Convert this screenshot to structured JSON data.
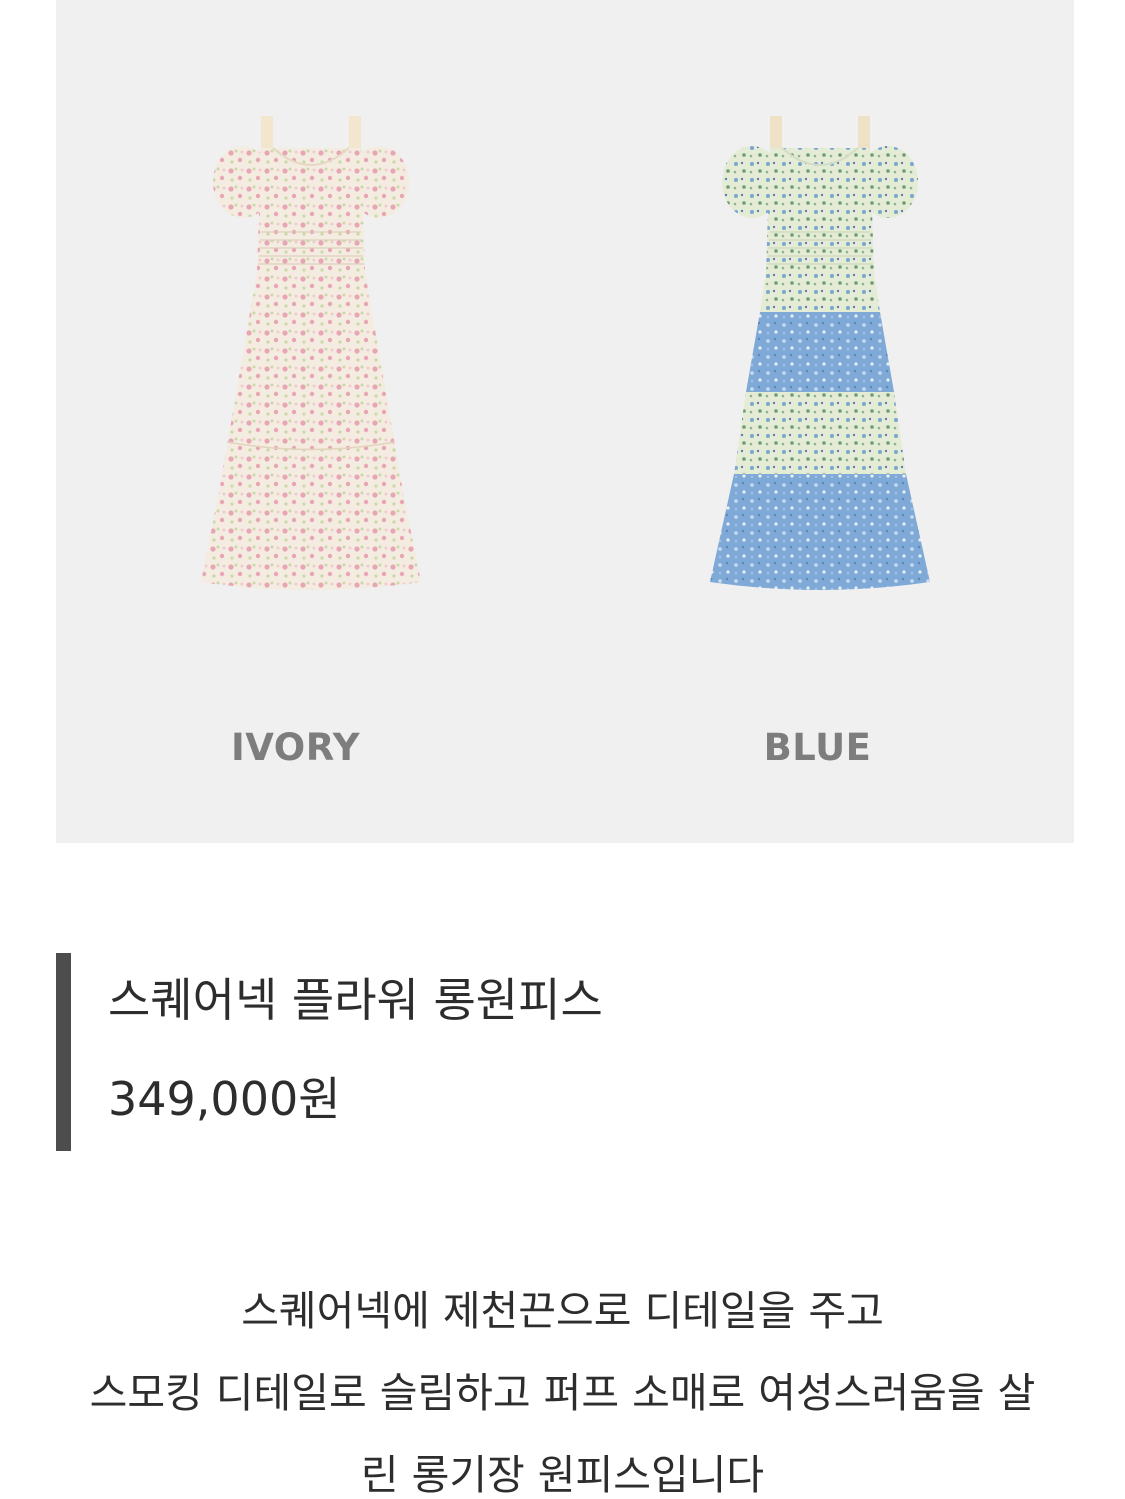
{
  "variants": [
    {
      "label": "IVORY",
      "colors": {
        "base": "#f4ece0",
        "floral_a": "#e8a6b5",
        "floral_b": "#c9d9a8",
        "lace": "#f2e6cf"
      }
    },
    {
      "label": "BLUE",
      "colors": {
        "base": "#e4ecd6",
        "floral_a": "#7aa5cf",
        "floral_b": "#6f9a6f",
        "tier": "#7fa9d6",
        "lace": "#efe1c6"
      }
    }
  ],
  "product": {
    "name": "스퀘어넥 플라워 롱원피스",
    "price": "349,000원"
  },
  "description": {
    "lines": [
      "스퀘어넥에 제천끈으로 디테일을 주고",
      "스모킹 디테일로 슬림하고 퍼프 소매로 여성스러움을 살",
      "린 롱기장 원피스입니다"
    ]
  },
  "colors": {
    "panel_bg": "#f0f0f0",
    "accent_bar": "#4d4d4d",
    "text": "#2d2d2d",
    "label_text": "#7d7d7d"
  }
}
